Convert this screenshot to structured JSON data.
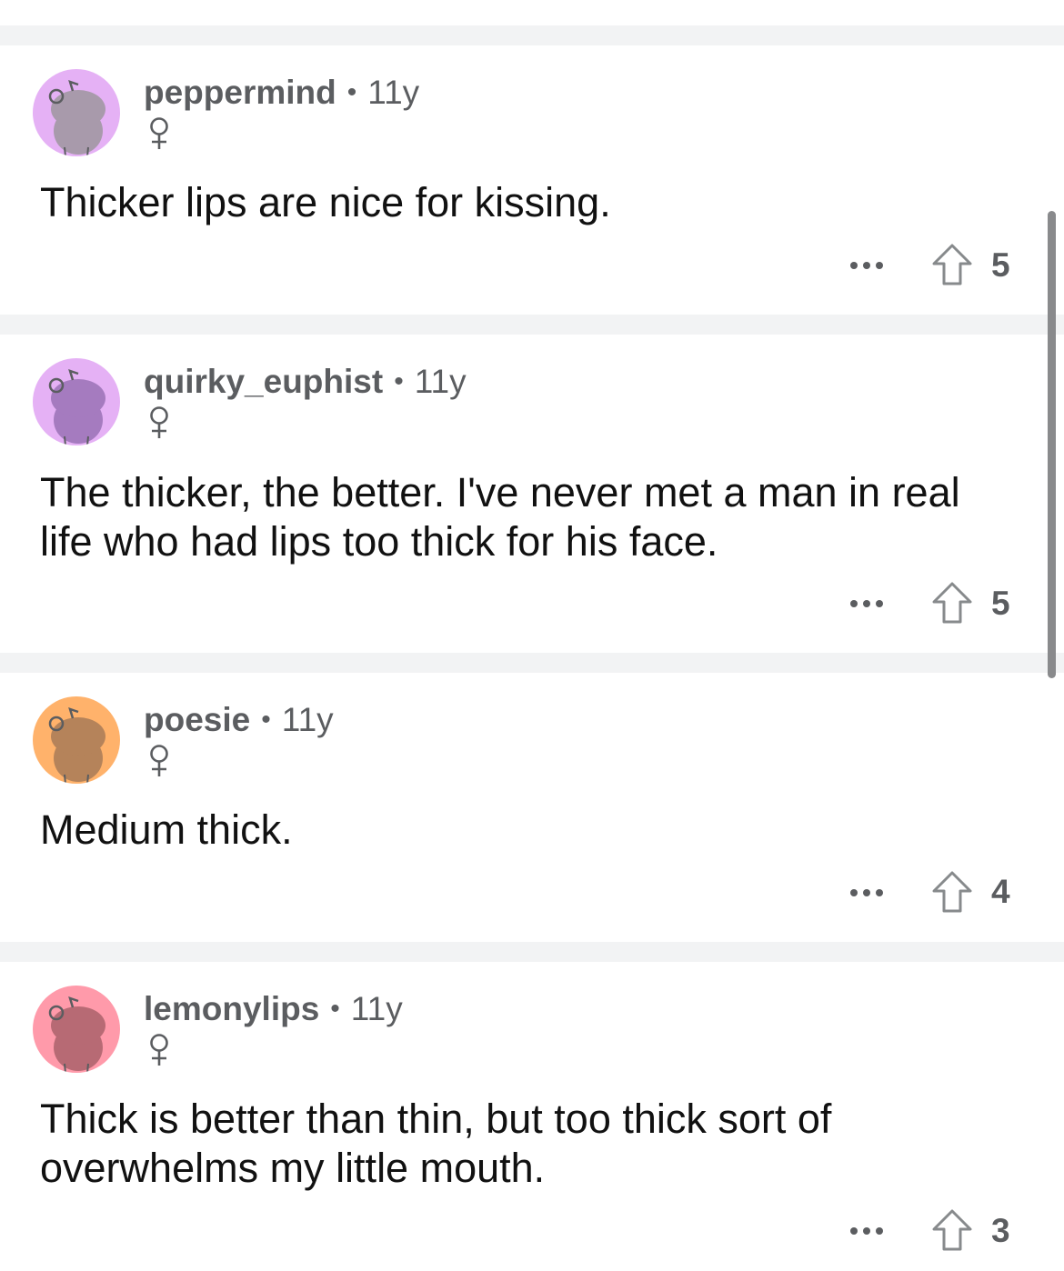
{
  "comments": [
    {
      "username": "peppermind",
      "separator": "•",
      "age": "11y",
      "flair": "♀",
      "text": "Thicker lips are nice for kissing.",
      "more": "•••",
      "votes": "5",
      "avatar_bg": "#e5b1f5",
      "avatar_fg": "#a89aab"
    },
    {
      "username": "quirky_euphist",
      "separator": "•",
      "age": "11y",
      "flair": "♀",
      "text": "The thicker, the better. I've never met a man in real life who had lips too thick for his face.",
      "more": "•••",
      "votes": "5",
      "avatar_bg": "#e5b1f5",
      "avatar_fg": "#a57bbf"
    },
    {
      "username": "poesie",
      "separator": "•",
      "age": "11y",
      "flair": "♀",
      "text": "Medium thick.",
      "more": "•••",
      "votes": "4",
      "avatar_bg": "#ffb26b",
      "avatar_fg": "#b5835a"
    },
    {
      "username": "lemonylips",
      "separator": "•",
      "age": "11y",
      "flair": "♀",
      "text": "Thick is better than thin, but too thick sort of overwhelms my little mouth.",
      "more": "•••",
      "votes": "3",
      "avatar_bg": "#ff9aaa",
      "avatar_fg": "#b76a74"
    }
  ],
  "colors": {
    "divider": "#f2f3f4",
    "meta_text": "#5b5d60",
    "body_text": "#111111"
  },
  "icons": {
    "avatar": "snoo-avatar-icon",
    "flair": "female-symbol-icon",
    "more": "more-options-icon",
    "upvote": "upvote-arrow-icon"
  }
}
